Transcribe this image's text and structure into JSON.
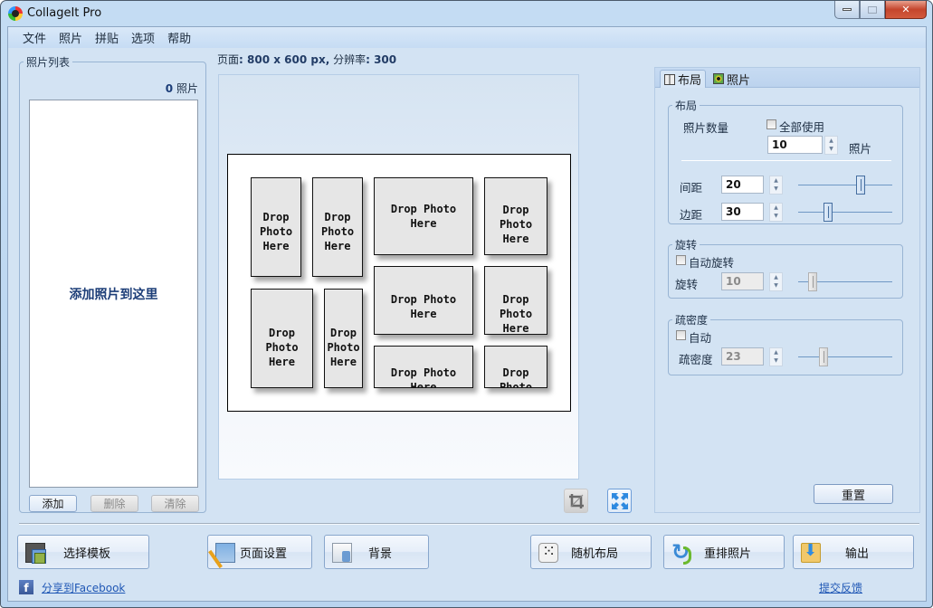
{
  "window": {
    "title": "CollageIt Pro",
    "controls": {
      "minimize": "minimize",
      "maximize": "maximize",
      "close": "close"
    }
  },
  "menu": {
    "items": [
      {
        "label": "文件"
      },
      {
        "label": "照片"
      },
      {
        "label": "拼贴"
      },
      {
        "label": "选项"
      },
      {
        "label": "帮助"
      }
    ]
  },
  "photo_list": {
    "legend": "照片列表",
    "count": "0",
    "count_unit": "照片",
    "empty_hint": "添加照片到这里",
    "buttons": {
      "add": "添加",
      "delete": "删除",
      "clear": "清除"
    }
  },
  "page_info": {
    "page_label": "页面",
    "page_value": ": 800 x 600 px,",
    "resolution_label": " 分辨率",
    "resolution_value": ": 300"
  },
  "canvas": {
    "slot_text": [
      "Drop",
      "Photo",
      "Here"
    ],
    "slots": [
      {
        "label": "Drop\nPhoto\nHere"
      },
      {
        "label": "Drop\nPhoto\nHere"
      },
      {
        "label": "Drop Photo\nHere"
      },
      {
        "label": "Drop\nPhoto\nHere"
      },
      {
        "label": "Drop Photo\nHere"
      },
      {
        "label": "Drop\nPhoto\nHere"
      },
      {
        "label": "Drop\nPhoto\nHere"
      },
      {
        "label": "Drop\nPhoto\nHere"
      },
      {
        "label": "Drop Photo\nHere"
      },
      {
        "label": "Drop\nPhoto\nHere"
      }
    ],
    "tools": {
      "crop": "crop-icon",
      "fit": "fit-to-window-icon"
    }
  },
  "right_panel": {
    "tabs": [
      {
        "label": "布局",
        "active": true
      },
      {
        "label": "照片",
        "active": false
      }
    ],
    "layout_group": {
      "legend": "布局",
      "photo_count_label": "照片数量",
      "use_all_label": "全部使用",
      "use_all_checked": false,
      "photo_count_value": "10",
      "photo_count_unit": "照片",
      "spacing_label": "间距",
      "spacing_value": "20",
      "spacing_slider_fraction": 0.68,
      "margin_label": "边距",
      "margin_value": "30",
      "margin_slider_fraction": 0.3
    },
    "rotation_group": {
      "legend": "旋转",
      "auto_rotate_label": "自动旋转",
      "auto_rotate_checked": false,
      "rotation_label": "旋转",
      "rotation_value": "10",
      "rotation_slider_fraction": 0.12
    },
    "density_group": {
      "legend": "疏密度",
      "auto_label": "自动",
      "auto_checked": false,
      "density_label": "疏密度",
      "density_value": "23",
      "density_slider_fraction": 0.24
    },
    "reset_label": "重置"
  },
  "bottom_bar": {
    "buttons": [
      {
        "label": "选择模板",
        "icon": "template-icon"
      },
      {
        "label": "页面设置",
        "icon": "page-setup-icon"
      },
      {
        "label": "背景",
        "icon": "background-icon"
      },
      {
        "label": "随机布局",
        "icon": "dice-icon"
      },
      {
        "label": "重排照片",
        "icon": "reorder-icon"
      },
      {
        "label": "输出",
        "icon": "export-icon"
      }
    ],
    "share_facebook": "分享到Facebook",
    "feedback": "提交反馈"
  }
}
